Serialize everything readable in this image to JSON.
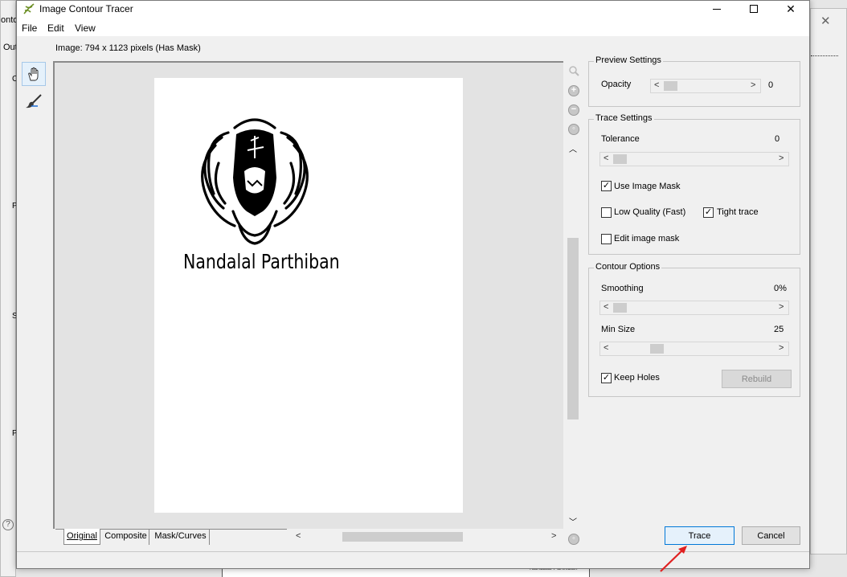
{
  "dialog": {
    "title": "Image Contour Tracer",
    "menu": [
      "File",
      "Edit",
      "View"
    ],
    "image_info": "Image: 794 x 1123 pixels (Has Mask)"
  },
  "preview": {
    "logo_name": "Nandalal Parthiban"
  },
  "tabs": [
    "Original",
    "Composite",
    "Mask/Curves"
  ],
  "preview_settings": {
    "legend": "Preview Settings",
    "opacity_label": "Opacity",
    "opacity_value": "0"
  },
  "trace_settings": {
    "legend": "Trace Settings",
    "tolerance_label": "Tolerance",
    "tolerance_value": "0",
    "use_image_mask": "Use Image Mask",
    "low_quality": "Low Quality (Fast)",
    "tight_trace": "Tight trace",
    "edit_image_mask": "Edit image mask"
  },
  "contour_options": {
    "legend": "Contour Options",
    "smoothing_label": "Smoothing",
    "smoothing_value": "0%",
    "min_size_label": "Min Size",
    "min_size_value": "25",
    "keep_holes": "Keep Holes",
    "rebuild": "Rebuild"
  },
  "buttons": {
    "trace": "Trace",
    "cancel": "Cancel"
  },
  "background": {
    "partial_title": "onto",
    "partial_tab": "Out",
    "side_letters": [
      "C",
      "P",
      "S",
      "P"
    ],
    "bottom_text": "Nandalal Parthiban"
  },
  "colors": {
    "trace_button_bg": "#e5f1fb",
    "trace_button_border": "#0078d7",
    "annotation_arrow": "#e02020"
  }
}
